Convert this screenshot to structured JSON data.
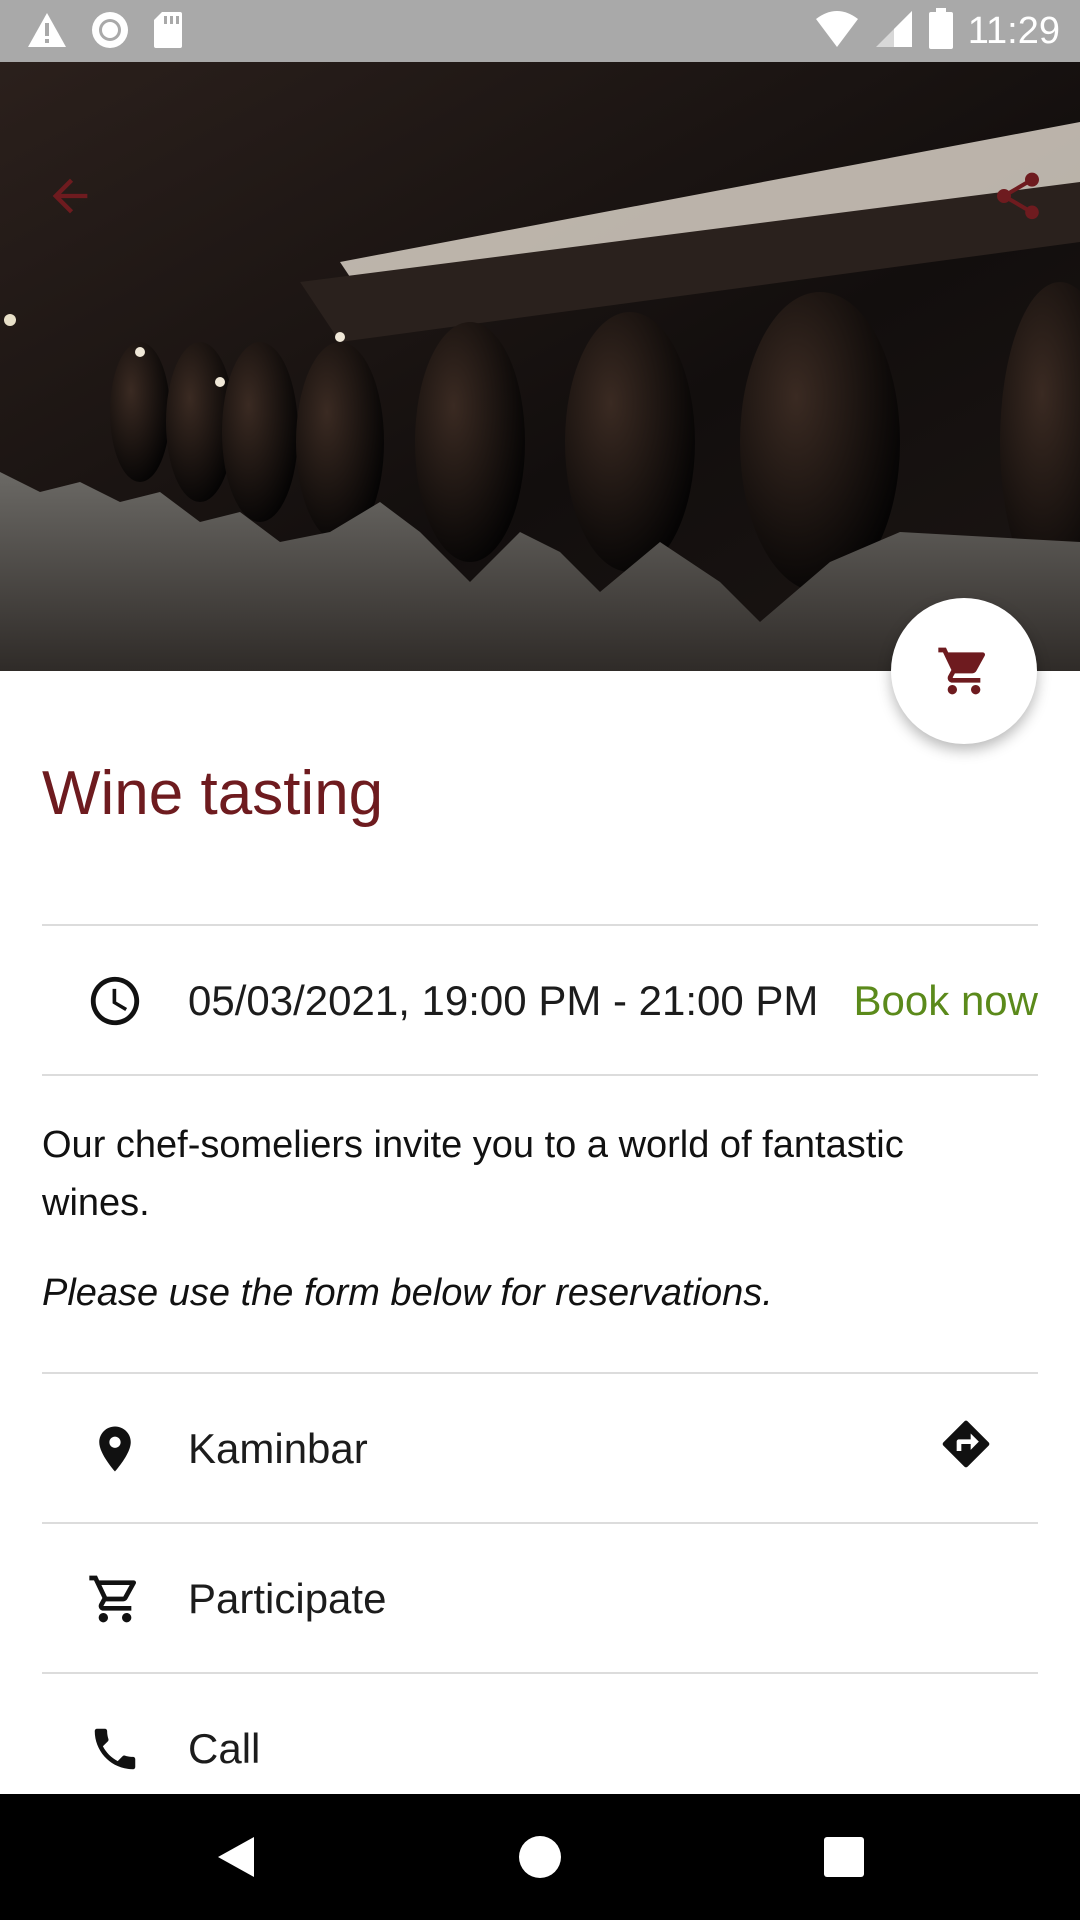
{
  "status_bar": {
    "time": "11:29",
    "icons_left": [
      "warning-icon",
      "circle-icon",
      "sdcard-icon"
    ],
    "icons_right": [
      "wifi-icon",
      "signal-icon",
      "battery-icon"
    ]
  },
  "hero": {
    "image_description": "wine-bottles-photo",
    "back_icon": "arrow-back-icon",
    "share_icon": "share-icon"
  },
  "fab": {
    "icon": "cart-icon"
  },
  "event": {
    "title": "Wine tasting",
    "datetime": "05/03/2021, 19:00 PM - 21:00 PM",
    "book_label": "Book now",
    "description": "Our chef-someliers invite you to a world of fantastic wines.",
    "note": "Please use the form below for reservations."
  },
  "actions": {
    "location_label": "Kaminbar",
    "participate_label": "Participate",
    "call_label": "Call"
  },
  "colors": {
    "accent": "#6e1b1f",
    "book": "#5b8a1b",
    "status_bar": "#a9a9a9"
  },
  "nav": [
    "back",
    "home",
    "recents"
  ]
}
